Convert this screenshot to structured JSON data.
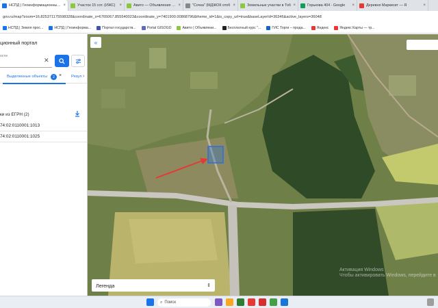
{
  "browser": {
    "tabs": [
      {
        "title": "НСПД | Геоинформационный портал",
        "active": true,
        "icon": "nspd-favicon",
        "color": "#1a73e8"
      },
      {
        "title": "Участок 15 сот. (ИЖС)",
        "active": false,
        "icon": "avito-favicon",
        "color": "#8dc63f"
      },
      {
        "title": "Авито — Объявления на сайте",
        "active": false,
        "icon": "avito-favicon",
        "color": "#8dc63f"
      },
      {
        "title": "\"Сочка\" (МДЖОК отоб",
        "active": false,
        "icon": "globe-favicon",
        "color": "#888888"
      },
      {
        "title": "Земельные участки в Тоб",
        "active": false,
        "icon": "avito-favicon",
        "color": "#8dc63f"
      },
      {
        "title": "Горькова 404 - Google",
        "active": false,
        "icon": "sheets-favicon",
        "color": "#0f9d58"
      },
      {
        "title": "Деревня Маркисит — Я",
        "active": false,
        "icon": "yandex-maps-favicon",
        "color": "#e53935"
      }
    ],
    "url": "gov.ru/map?zoom=16.825371175598328&coordinate_x=6765067.855540023&coordinate_y=7401900.00868796&theme_id=1&is_copy_url=true&baseLayerId=36346&active_layers=36048",
    "bookmarks": [
      {
        "label": "НСПД | Земля прос...",
        "color": "#1a73e8"
      },
      {
        "label": "НСПД | Геоинформа...",
        "color": "#1a73e8"
      },
      {
        "label": "Портал государств...",
        "color": "#3f51b5"
      },
      {
        "label": "Portal GISOGD",
        "color": "#5c6bc0"
      },
      {
        "label": "Авито | Объявлени...",
        "color": "#8dc63f"
      },
      {
        "label": "Бесплатный курс \"...",
        "color": "#222222"
      },
      {
        "label": "ГИС Торги – прода...",
        "color": "#1565c0"
      },
      {
        "label": "Яндекс",
        "color": "#e53935"
      },
      {
        "label": "Яндекс Карты — тр...",
        "color": "#e53935"
      }
    ]
  },
  "panel": {
    "title": "ционный портал",
    "search_label": "ости",
    "tabs": {
      "selected_label": "Выделенные объекты",
      "selected_count": "2",
      "results_label": "Резул"
    },
    "egrn_heading": "ки из ЕГРН (2)",
    "records": [
      "74:02:0110001:1013",
      "74:02:0110001:1025"
    ]
  },
  "map": {
    "legend_label": "Легенда",
    "watermark": [
      "Активация Windows",
      "Чтобы активировать Windows, перейдите в"
    ]
  },
  "taskbar": {
    "search_label": "Поиск"
  },
  "colors": {
    "accent": "#1a73e8",
    "selection": "#2f6fd8",
    "arrow": "#e53935"
  }
}
